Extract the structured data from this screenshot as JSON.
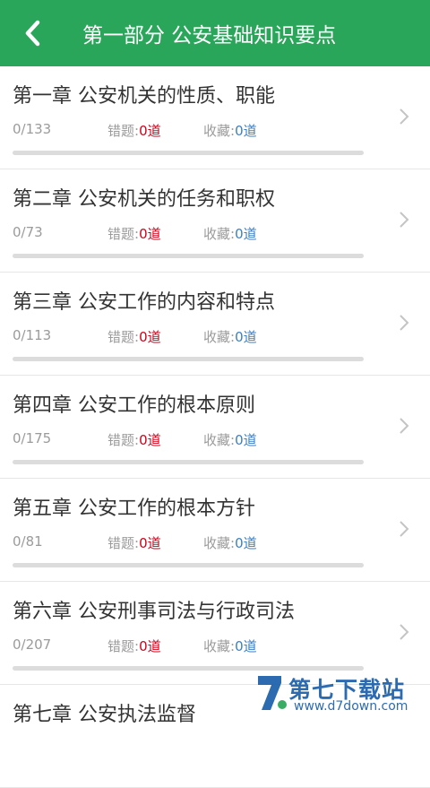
{
  "header": {
    "title": "第一部分 公安基础知识要点",
    "back_icon": "chevron-left-icon"
  },
  "labels": {
    "wrong": "错题:",
    "favorite": "收藏:"
  },
  "colors": {
    "header": "#2aa65a",
    "wrong_count": "#d0021b",
    "favorite_count": "#3b7fc4"
  },
  "chapters": [
    {
      "title": "第一章 公安机关的性质、职能",
      "progress": "0/133",
      "wrong": "0道",
      "favorite": "0道",
      "progress_fraction": 0
    },
    {
      "title": "第二章 公安机关的任务和职权",
      "progress": "0/73",
      "wrong": "0道",
      "favorite": "0道",
      "progress_fraction": 0
    },
    {
      "title": "第三章 公安工作的内容和特点",
      "progress": "0/113",
      "wrong": "0道",
      "favorite": "0道",
      "progress_fraction": 0
    },
    {
      "title": "第四章 公安工作的根本原则",
      "progress": "0/175",
      "wrong": "0道",
      "favorite": "0道",
      "progress_fraction": 0
    },
    {
      "title": "第五章 公安工作的根本方针",
      "progress": "0/81",
      "wrong": "0道",
      "favorite": "0道",
      "progress_fraction": 0
    },
    {
      "title": "第六章 公安刑事司法与行政司法",
      "progress": "0/207",
      "wrong": "0道",
      "favorite": "0道",
      "progress_fraction": 0
    },
    {
      "title": "第七章 公安执法监督",
      "progress": "",
      "wrong": "",
      "favorite": "",
      "progress_fraction": 0
    }
  ],
  "watermark": {
    "text": "第七下载站",
    "url": "www.d7down.com"
  }
}
